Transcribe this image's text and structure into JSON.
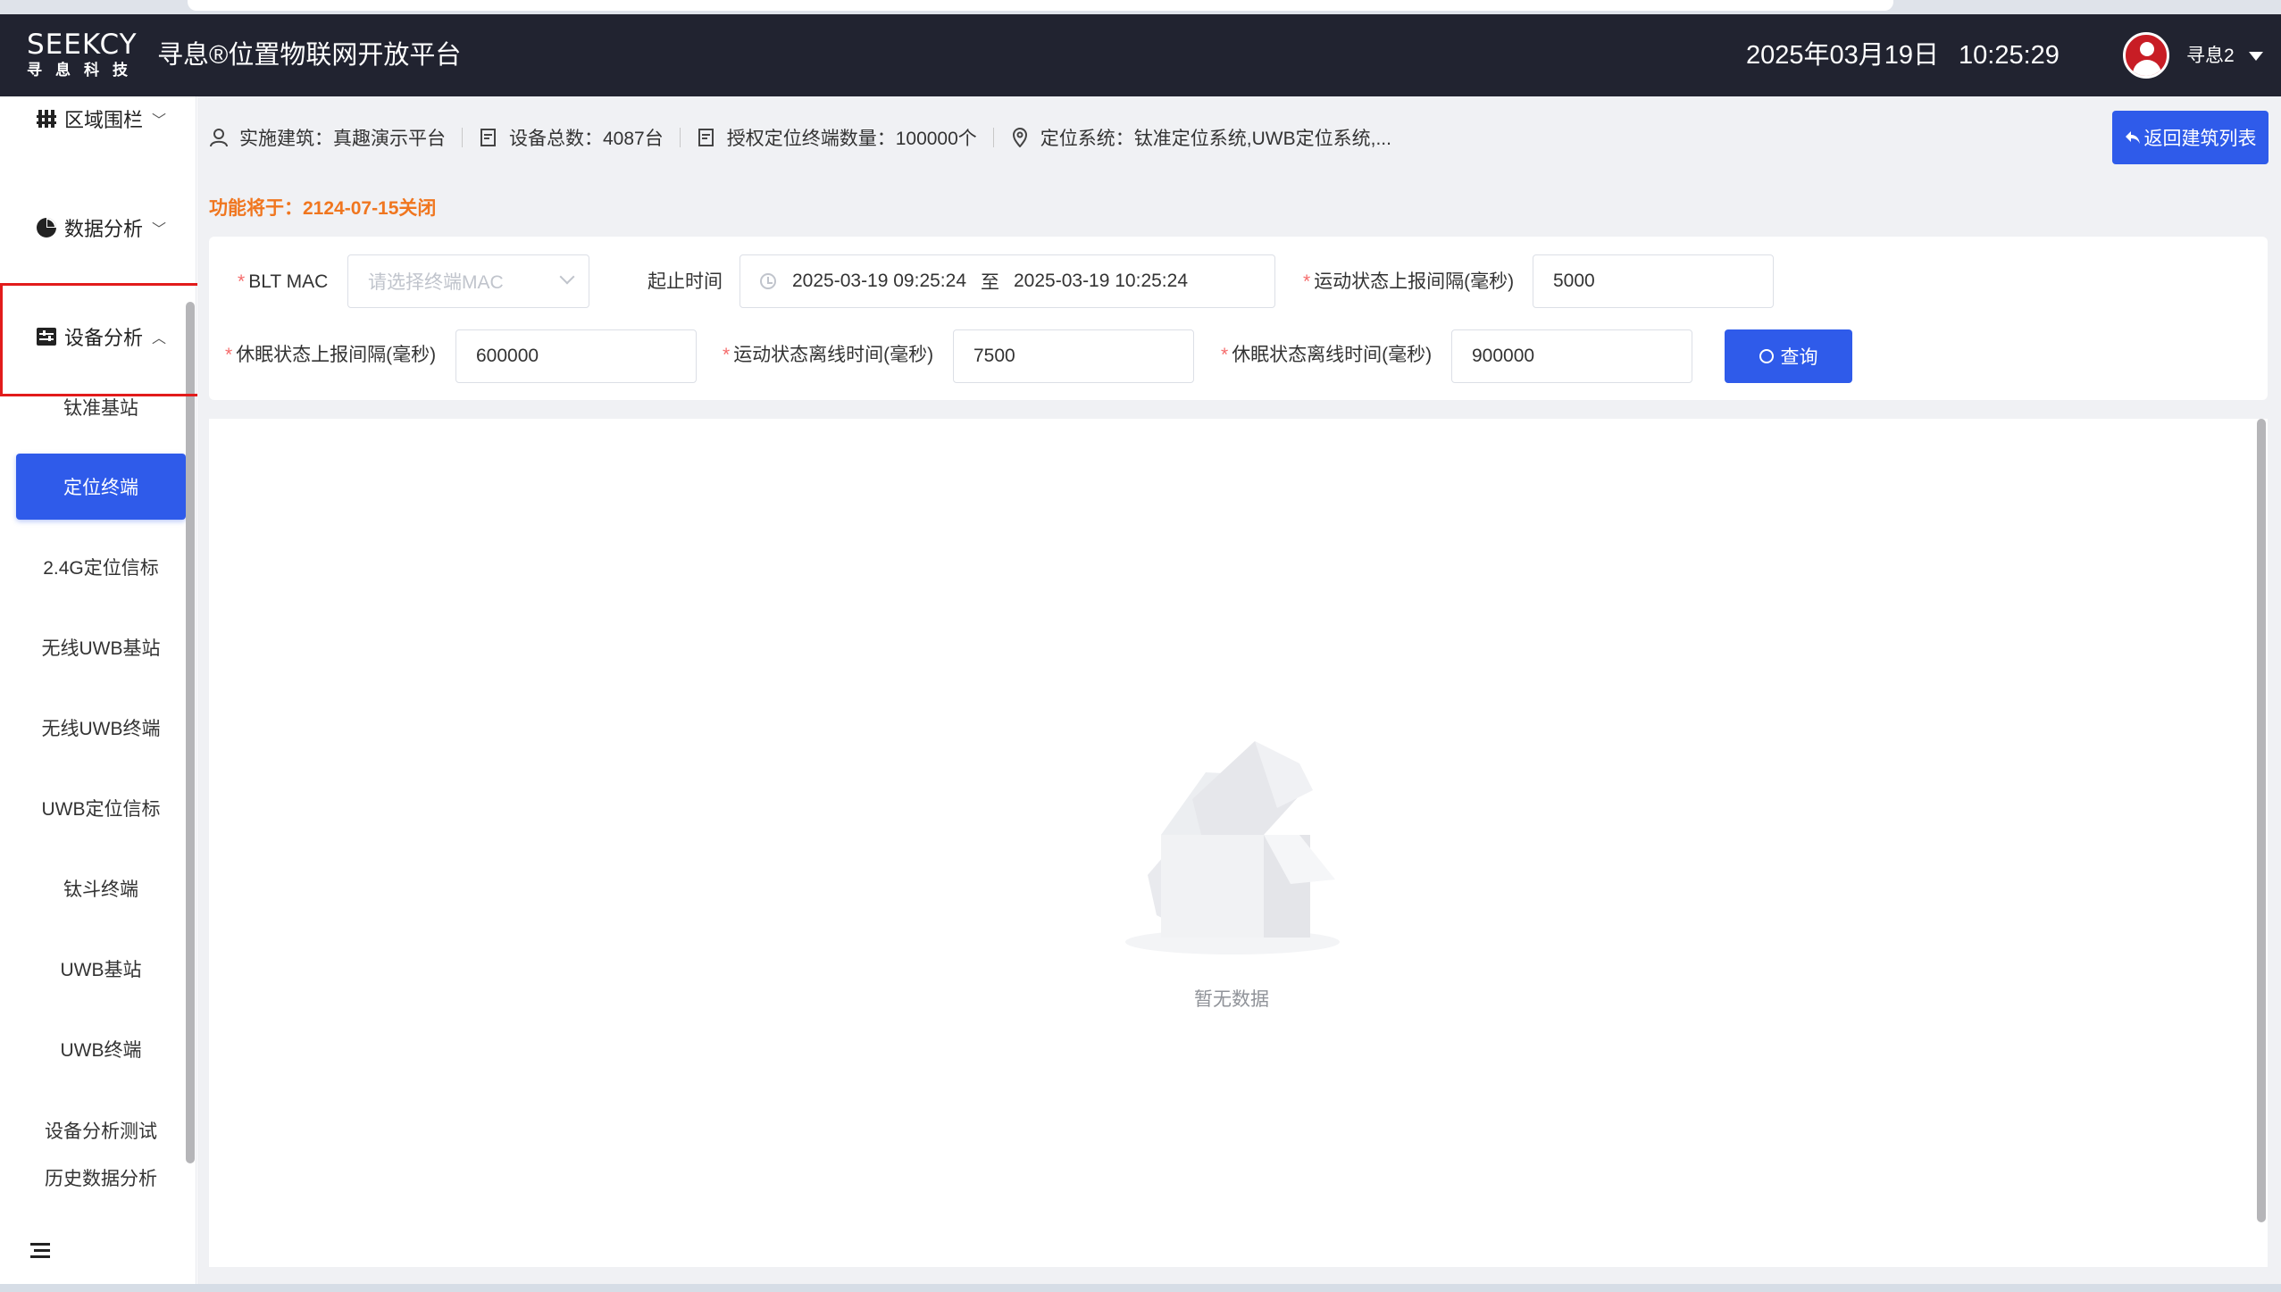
{
  "header": {
    "logo_brand": "SEEKCY",
    "logo_sub": "寻息科技",
    "title": "寻息®位置物联网开放平台",
    "date": "2025年03月19日",
    "time": "10:25:29",
    "username": "寻息2"
  },
  "sidebar": {
    "groups": [
      {
        "label": "区域围栏",
        "icon": "fence-icon"
      },
      {
        "label": "数据分析",
        "icon": "pie-chart-icon"
      },
      {
        "label": "设备分析",
        "icon": "device-analysis-icon",
        "expanded": true
      }
    ],
    "items": [
      {
        "label": "钛准基站"
      },
      {
        "label": "定位终端",
        "active": true
      },
      {
        "label": "2.4G定位信标"
      },
      {
        "label": "无线UWB基站"
      },
      {
        "label": "无线UWB终端"
      },
      {
        "label": "UWB定位信标"
      },
      {
        "label": "钛斗终端"
      },
      {
        "label": "UWB基站"
      },
      {
        "label": "UWB终端"
      },
      {
        "label": "设备分析测试"
      },
      {
        "label": "历史数据分析"
      }
    ]
  },
  "info_bar": {
    "building": "实施建筑：真趣演示平台",
    "device_total": "设备总数：4087台",
    "licensed_terminals": "授权定位终端数量：100000个",
    "positioning_system": "定位系统：钛准定位系统,UWB定位系统,..."
  },
  "back_button": "返回建筑列表",
  "notice": "功能将于：2124-07-15关闭",
  "filters": {
    "blt_mac_label": "BLT MAC",
    "blt_mac_placeholder": "请选择终端MAC",
    "time_range_label": "起止时间",
    "time_start": "2025-03-19 09:25:24",
    "time_sep": "至",
    "time_end": "2025-03-19 10:25:24",
    "motion_report_label": "运动状态上报间隔(毫秒)",
    "motion_report_value": "5000",
    "sleep_report_label": "休眠状态上报间隔(毫秒)",
    "sleep_report_value": "600000",
    "motion_offline_label": "运动状态离线时间(毫秒)",
    "motion_offline_value": "7500",
    "sleep_offline_label": "休眠状态离线时间(毫秒)",
    "sleep_offline_value": "900000",
    "query_button": "查询"
  },
  "empty_state": {
    "text": "暂无数据"
  },
  "colors": {
    "header_bg": "#212330",
    "primary": "#2f5bea",
    "notice": "#f0761f",
    "highlight_border": "#e21b1b"
  }
}
